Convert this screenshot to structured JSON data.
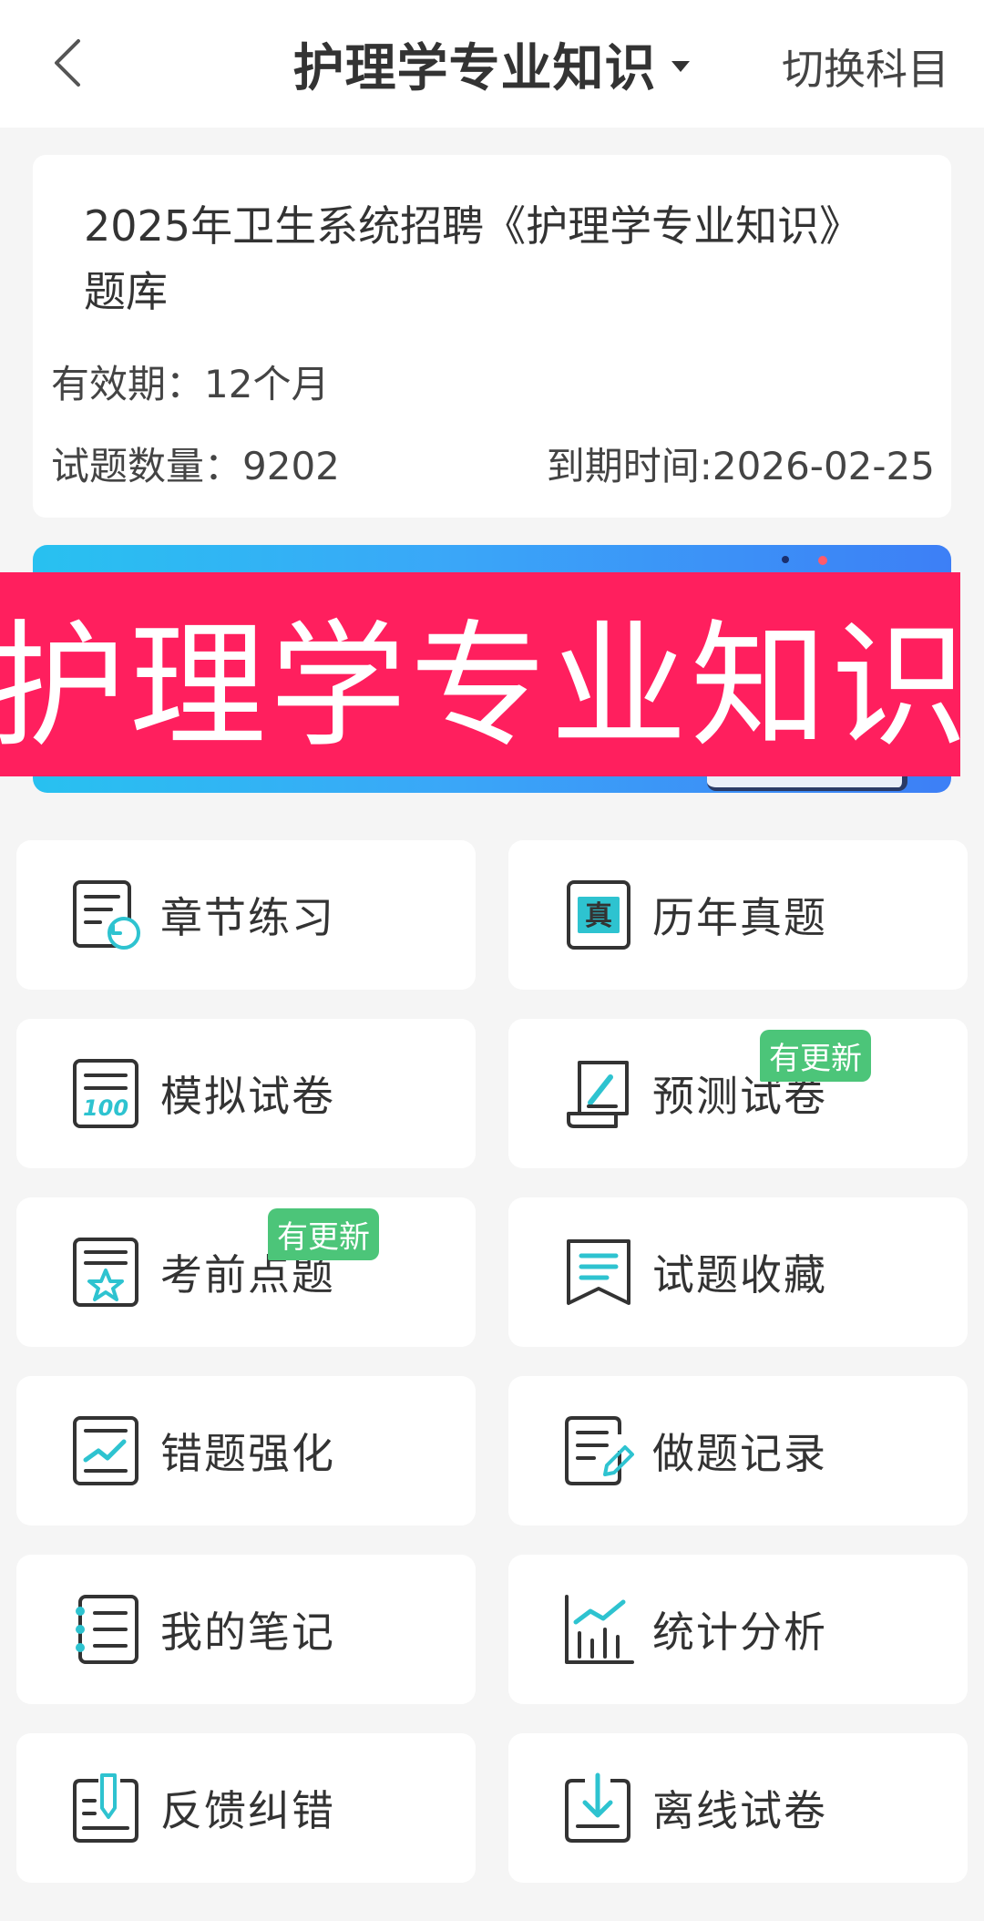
{
  "header": {
    "title": "护理学专业知识",
    "switch_label": "切换科目"
  },
  "info": {
    "bank_title": "2025年卫生系统招聘《护理学专业知识》题库",
    "validity": "有效期：12个月",
    "count": "试题数量：9202",
    "expire": "到期时间:2026-02-25"
  },
  "banner": {
    "overlay_text": "护理学专业知识"
  },
  "menu": [
    {
      "label": "章节练习",
      "icon": "chapter-practice-icon"
    },
    {
      "label": "历年真题",
      "icon": "past-exams-icon"
    },
    {
      "label": "模拟试卷",
      "icon": "mock-exam-icon"
    },
    {
      "label": "预测试卷",
      "icon": "forecast-exam-icon",
      "badge": "有更新"
    },
    {
      "label": "考前点题",
      "icon": "pre-exam-tips-icon",
      "badge": "有更新"
    },
    {
      "label": "试题收藏",
      "icon": "bookmark-icon"
    },
    {
      "label": "错题强化",
      "icon": "wrong-questions-icon"
    },
    {
      "label": "做题记录",
      "icon": "practice-record-icon"
    },
    {
      "label": "我的笔记",
      "icon": "notes-icon"
    },
    {
      "label": "统计分析",
      "icon": "statistics-icon"
    },
    {
      "label": "反馈纠错",
      "icon": "feedback-icon"
    },
    {
      "label": "离线试卷",
      "icon": "offline-download-icon"
    }
  ],
  "colors": {
    "accent": "#2ec3d0",
    "badge": "#4cc579",
    "overlay": "#ff1f5e",
    "banner_start": "#28c1f0",
    "banner_end": "#3d7ff6"
  }
}
